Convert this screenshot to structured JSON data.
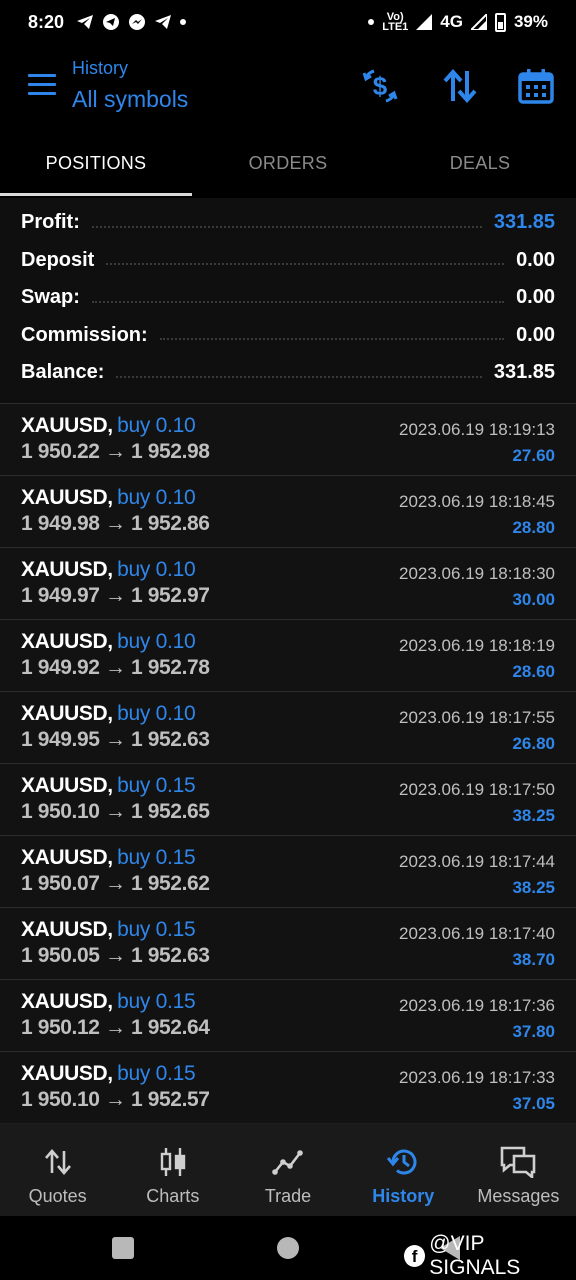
{
  "status_bar": {
    "time": "8:20",
    "network_small_top": "Vo)",
    "network_small_bottom": "LTE1",
    "network": "4G",
    "battery": "39%"
  },
  "header": {
    "subtitle": "History",
    "title": "All symbols",
    "accent_color": "#2f86ea"
  },
  "tabs": [
    {
      "label": "POSITIONS",
      "active": true
    },
    {
      "label": "ORDERS",
      "active": false
    },
    {
      "label": "DEALS",
      "active": false
    }
  ],
  "summary": [
    {
      "label": "Profit:",
      "value": "331.85"
    },
    {
      "label": "Deposit",
      "value": "0.00"
    },
    {
      "label": "Swap:",
      "value": "0.00"
    },
    {
      "label": "Commission:",
      "value": "0.00"
    },
    {
      "label": "Balance:",
      "value": "331.85"
    }
  ],
  "deals": [
    {
      "symbol": "XAUUSD,",
      "side": "buy 0.10",
      "open": "1 950.22",
      "arrow": "→",
      "close": "1 952.98",
      "time": "2023.06.19 18:19:13",
      "profit": "27.60"
    },
    {
      "symbol": "XAUUSD,",
      "side": "buy 0.10",
      "open": "1 949.98",
      "arrow": "→",
      "close": "1 952.86",
      "time": "2023.06.19 18:18:45",
      "profit": "28.80"
    },
    {
      "symbol": "XAUUSD,",
      "side": "buy 0.10",
      "open": "1 949.97",
      "arrow": "→",
      "close": "1 952.97",
      "time": "2023.06.19 18:18:30",
      "profit": "30.00"
    },
    {
      "symbol": "XAUUSD,",
      "side": "buy 0.10",
      "open": "1 949.92",
      "arrow": "→",
      "close": "1 952.78",
      "time": "2023.06.19 18:18:19",
      "profit": "28.60"
    },
    {
      "symbol": "XAUUSD,",
      "side": "buy 0.10",
      "open": "1 949.95",
      "arrow": "→",
      "close": "1 952.63",
      "time": "2023.06.19 18:17:55",
      "profit": "26.80"
    },
    {
      "symbol": "XAUUSD,",
      "side": "buy 0.15",
      "open": "1 950.10",
      "arrow": "→",
      "close": "1 952.65",
      "time": "2023.06.19 18:17:50",
      "profit": "38.25"
    },
    {
      "symbol": "XAUUSD,",
      "side": "buy 0.15",
      "open": "1 950.07",
      "arrow": "→",
      "close": "1 952.62",
      "time": "2023.06.19 18:17:44",
      "profit": "38.25"
    },
    {
      "symbol": "XAUUSD,",
      "side": "buy 0.15",
      "open": "1 950.05",
      "arrow": "→",
      "close": "1 952.63",
      "time": "2023.06.19 18:17:40",
      "profit": "38.70"
    },
    {
      "symbol": "XAUUSD,",
      "side": "buy 0.15",
      "open": "1 950.12",
      "arrow": "→",
      "close": "1 952.64",
      "time": "2023.06.19 18:17:36",
      "profit": "37.80"
    },
    {
      "symbol": "XAUUSD,",
      "side": "buy 0.15",
      "open": "1 950.10",
      "arrow": "→",
      "close": "1 952.57",
      "time": "2023.06.19 18:17:33",
      "profit": "37.05"
    }
  ],
  "bottom_nav": [
    {
      "label": "Quotes",
      "icon": "quotes-icon",
      "active": false
    },
    {
      "label": "Charts",
      "icon": "charts-icon",
      "active": false
    },
    {
      "label": "Trade",
      "icon": "trade-icon",
      "active": false
    },
    {
      "label": "History",
      "icon": "history-icon",
      "active": true
    },
    {
      "label": "Messages",
      "icon": "messages-icon",
      "active": false
    }
  ],
  "watermark": {
    "logo_letter": "f",
    "text": "@VIP SIGNALS"
  }
}
